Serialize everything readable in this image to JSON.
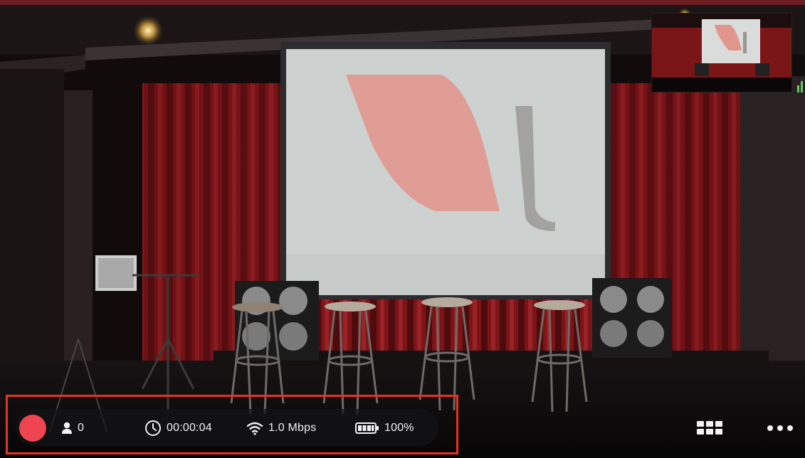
{
  "status_bar": {
    "record_state": "recording",
    "viewer_count": "0",
    "duration": "00:00:04",
    "bitrate": "1.0 Mbps",
    "battery": "100%"
  },
  "icons": {
    "record": "record-dot-icon",
    "viewers": "person-icon",
    "duration": "clock-icon",
    "bitrate": "wifi-icon",
    "battery": "battery-icon",
    "layout": "grid-icon",
    "more": "ellipsis-icon"
  },
  "colors": {
    "record": "#ee4550",
    "highlight": "#e8321f",
    "signal": "#5fd160"
  }
}
